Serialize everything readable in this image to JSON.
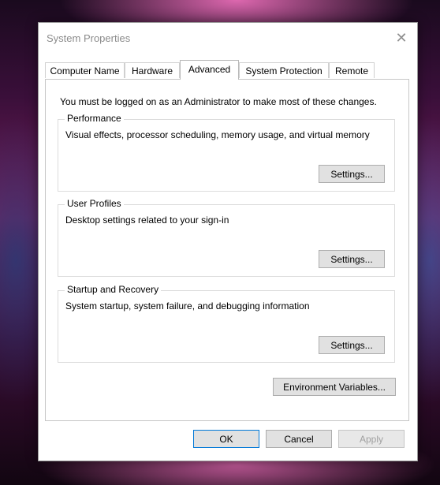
{
  "window": {
    "title": "System Properties",
    "close_glyph": "✕"
  },
  "tabs": [
    {
      "label": "Computer Name"
    },
    {
      "label": "Hardware"
    },
    {
      "label": "Advanced",
      "active": true
    },
    {
      "label": "System Protection"
    },
    {
      "label": "Remote"
    }
  ],
  "advanced": {
    "admin_note": "You must be logged on as an Administrator to make most of these changes.",
    "performance": {
      "title": "Performance",
      "description": "Visual effects, processor scheduling, memory usage, and virtual memory",
      "settings_label": "Settings..."
    },
    "user_profiles": {
      "title": "User Profiles",
      "description": "Desktop settings related to your sign-in",
      "settings_label": "Settings..."
    },
    "startup_recovery": {
      "title": "Startup and Recovery",
      "description": "System startup, system failure, and debugging information",
      "settings_label": "Settings..."
    },
    "env_vars_label": "Environment Variables..."
  },
  "footer": {
    "ok_label": "OK",
    "cancel_label": "Cancel",
    "apply_label": "Apply"
  },
  "colors": {
    "focus_border": "#0078d7",
    "button_face": "#e1e1e1",
    "disabled_text": "#a0a0a0"
  }
}
